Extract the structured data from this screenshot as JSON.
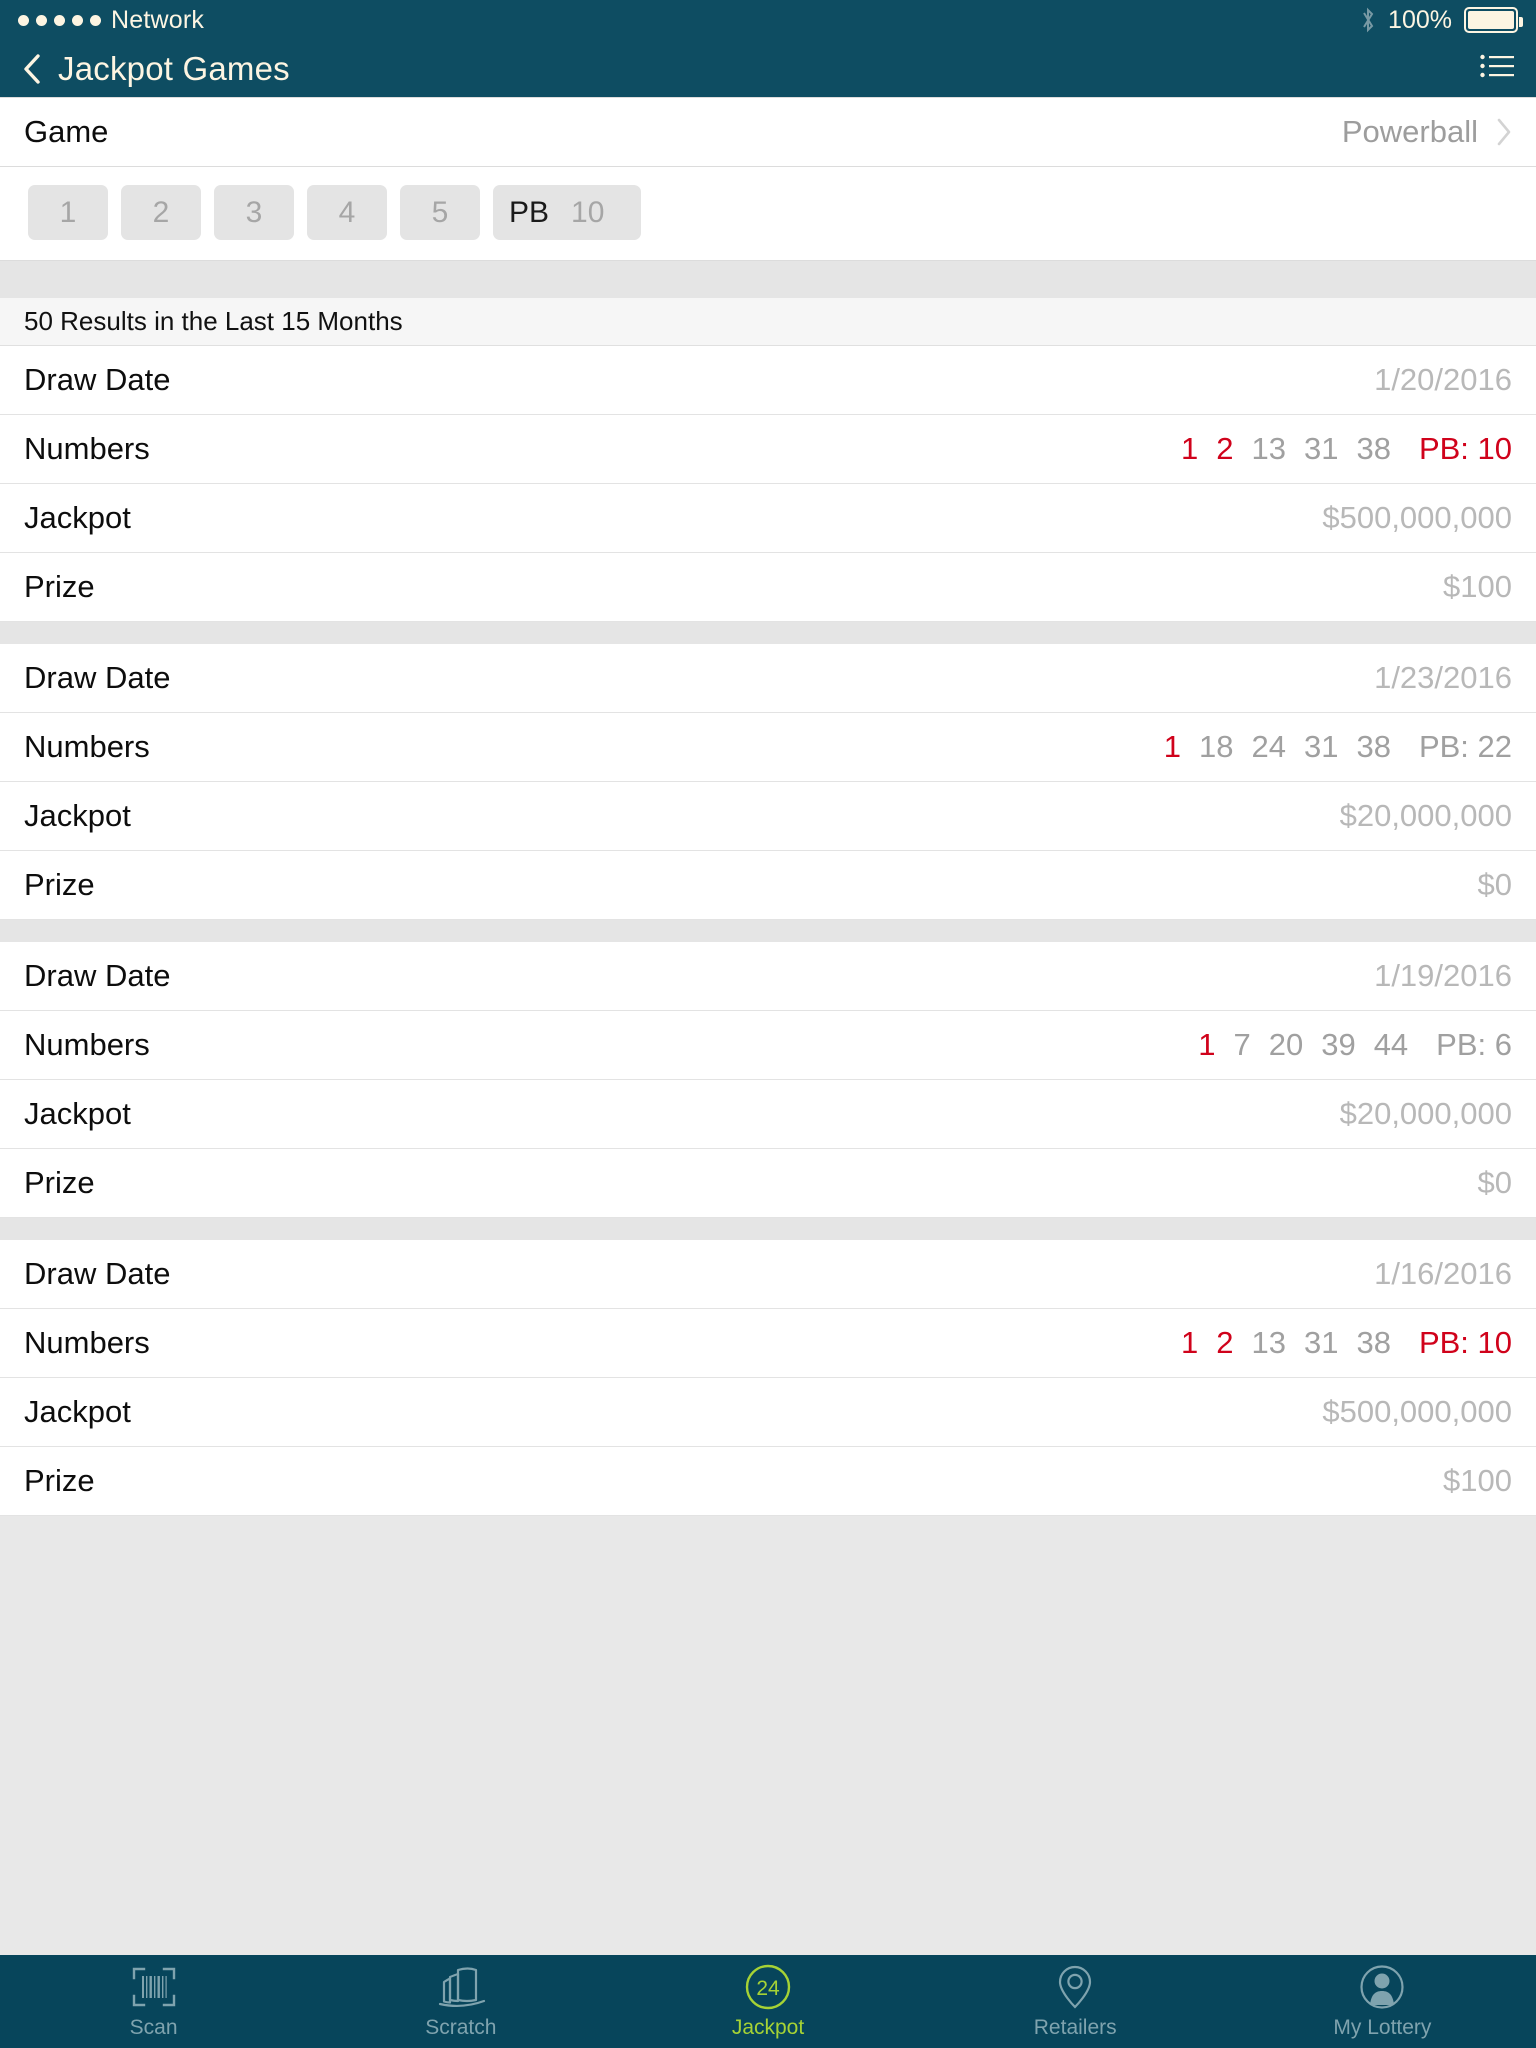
{
  "status_bar": {
    "signal_dots": 5,
    "carrier": "Network",
    "bluetooth_icon": "bluetooth-icon",
    "battery_percent": "100%",
    "battery_level": 100
  },
  "nav_bar": {
    "back_icon": "chevron-left-icon",
    "title": "Jackpot Games",
    "menu_icon": "list-icon"
  },
  "game_row": {
    "label": "Game",
    "value": "Powerball",
    "disclosure_icon": "chevron-right-icon"
  },
  "filters": {
    "boxes": [
      {
        "placeholder": "1",
        "value": ""
      },
      {
        "placeholder": "2",
        "value": ""
      },
      {
        "placeholder": "3",
        "value": ""
      },
      {
        "placeholder": "4",
        "value": ""
      },
      {
        "placeholder": "5",
        "value": ""
      }
    ],
    "powerball": {
      "label": "PB",
      "placeholder": "10",
      "value": ""
    }
  },
  "section_header": "50 Results in the Last 15 Months",
  "row_labels": {
    "draw_date": "Draw Date",
    "numbers": "Numbers",
    "jackpot": "Jackpot",
    "prize": "Prize"
  },
  "colors": {
    "nav_background": "#0e4d62",
    "tabbar_background": "#07455b",
    "accent_active": "#a6d235",
    "match_red": "#d0021b",
    "value_gray": "#b8b8b8"
  },
  "results": [
    {
      "draw_date": "1/20/2016",
      "numbers": [
        {
          "n": "1",
          "match": true
        },
        {
          "n": "2",
          "match": true
        },
        {
          "n": "13",
          "match": false
        },
        {
          "n": "31",
          "match": false
        },
        {
          "n": "38",
          "match": false
        }
      ],
      "powerball": {
        "text": "PB: 10",
        "match": true
      },
      "jackpot": "$500,000,000",
      "prize": "$100"
    },
    {
      "draw_date": "1/23/2016",
      "numbers": [
        {
          "n": "1",
          "match": true
        },
        {
          "n": "18",
          "match": false
        },
        {
          "n": "24",
          "match": false
        },
        {
          "n": "31",
          "match": false
        },
        {
          "n": "38",
          "match": false
        }
      ],
      "powerball": {
        "text": "PB: 22",
        "match": false
      },
      "jackpot": "$20,000,000",
      "prize": "$0"
    },
    {
      "draw_date": "1/19/2016",
      "numbers": [
        {
          "n": "1",
          "match": true
        },
        {
          "n": "7",
          "match": false
        },
        {
          "n": "20",
          "match": false
        },
        {
          "n": "39",
          "match": false
        },
        {
          "n": "44",
          "match": false
        }
      ],
      "powerball": {
        "text": "PB: 6",
        "match": false
      },
      "jackpot": "$20,000,000",
      "prize": "$0"
    },
    {
      "draw_date": "1/16/2016",
      "numbers": [
        {
          "n": "1",
          "match": true
        },
        {
          "n": "2",
          "match": true
        },
        {
          "n": "13",
          "match": false
        },
        {
          "n": "31",
          "match": false
        },
        {
          "n": "38",
          "match": false
        }
      ],
      "powerball": {
        "text": "PB: 10",
        "match": true
      },
      "jackpot": "$500,000,000",
      "prize": "$100"
    }
  ],
  "tabs": [
    {
      "label": "Scan",
      "icon": "barcode-scan-icon",
      "active": false,
      "badge": ""
    },
    {
      "label": "Scratch",
      "icon": "scratch-tickets-icon",
      "active": false,
      "badge": ""
    },
    {
      "label": "Jackpot",
      "icon": "jackpot-countdown-icon",
      "active": true,
      "badge": "24"
    },
    {
      "label": "Retailers",
      "icon": "map-pin-icon",
      "active": false,
      "badge": ""
    },
    {
      "label": "My Lottery",
      "icon": "user-avatar-icon",
      "active": false,
      "badge": ""
    }
  ]
}
